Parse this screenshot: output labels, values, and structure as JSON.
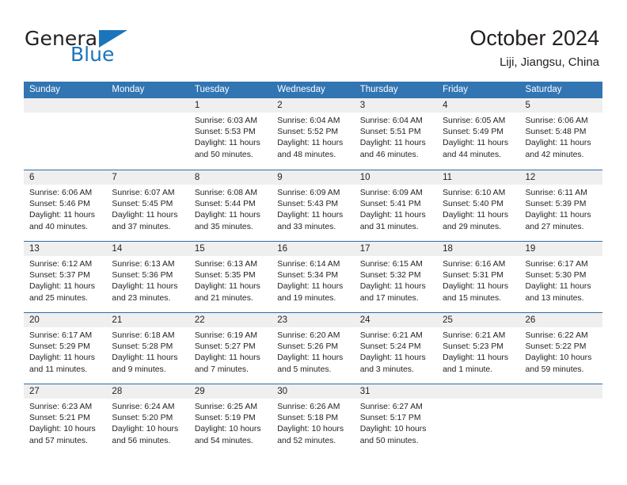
{
  "brand": {
    "name_top": "General",
    "name_bottom": "Blue",
    "accent_color": "#1b75bb"
  },
  "header": {
    "title": "October 2024",
    "subtitle": "Liji, Jiangsu, China"
  },
  "theme": {
    "header_blue": "#3275b3",
    "row_border_blue": "#2e6da4",
    "day_band_gray": "#efefef",
    "text_color": "#231f20"
  },
  "weekdays": [
    "Sunday",
    "Monday",
    "Tuesday",
    "Wednesday",
    "Thursday",
    "Friday",
    "Saturday"
  ],
  "weeks": [
    [
      {
        "day": "",
        "sunrise": "",
        "sunset": "",
        "daylight_line1": "",
        "daylight_line2": ""
      },
      {
        "day": "",
        "sunrise": "",
        "sunset": "",
        "daylight_line1": "",
        "daylight_line2": ""
      },
      {
        "day": "1",
        "sunrise": "Sunrise: 6:03 AM",
        "sunset": "Sunset: 5:53 PM",
        "daylight_line1": "Daylight: 11 hours",
        "daylight_line2": "and 50 minutes."
      },
      {
        "day": "2",
        "sunrise": "Sunrise: 6:04 AM",
        "sunset": "Sunset: 5:52 PM",
        "daylight_line1": "Daylight: 11 hours",
        "daylight_line2": "and 48 minutes."
      },
      {
        "day": "3",
        "sunrise": "Sunrise: 6:04 AM",
        "sunset": "Sunset: 5:51 PM",
        "daylight_line1": "Daylight: 11 hours",
        "daylight_line2": "and 46 minutes."
      },
      {
        "day": "4",
        "sunrise": "Sunrise: 6:05 AM",
        "sunset": "Sunset: 5:49 PM",
        "daylight_line1": "Daylight: 11 hours",
        "daylight_line2": "and 44 minutes."
      },
      {
        "day": "5",
        "sunrise": "Sunrise: 6:06 AM",
        "sunset": "Sunset: 5:48 PM",
        "daylight_line1": "Daylight: 11 hours",
        "daylight_line2": "and 42 minutes."
      }
    ],
    [
      {
        "day": "6",
        "sunrise": "Sunrise: 6:06 AM",
        "sunset": "Sunset: 5:46 PM",
        "daylight_line1": "Daylight: 11 hours",
        "daylight_line2": "and 40 minutes."
      },
      {
        "day": "7",
        "sunrise": "Sunrise: 6:07 AM",
        "sunset": "Sunset: 5:45 PM",
        "daylight_line1": "Daylight: 11 hours",
        "daylight_line2": "and 37 minutes."
      },
      {
        "day": "8",
        "sunrise": "Sunrise: 6:08 AM",
        "sunset": "Sunset: 5:44 PM",
        "daylight_line1": "Daylight: 11 hours",
        "daylight_line2": "and 35 minutes."
      },
      {
        "day": "9",
        "sunrise": "Sunrise: 6:09 AM",
        "sunset": "Sunset: 5:43 PM",
        "daylight_line1": "Daylight: 11 hours",
        "daylight_line2": "and 33 minutes."
      },
      {
        "day": "10",
        "sunrise": "Sunrise: 6:09 AM",
        "sunset": "Sunset: 5:41 PM",
        "daylight_line1": "Daylight: 11 hours",
        "daylight_line2": "and 31 minutes."
      },
      {
        "day": "11",
        "sunrise": "Sunrise: 6:10 AM",
        "sunset": "Sunset: 5:40 PM",
        "daylight_line1": "Daylight: 11 hours",
        "daylight_line2": "and 29 minutes."
      },
      {
        "day": "12",
        "sunrise": "Sunrise: 6:11 AM",
        "sunset": "Sunset: 5:39 PM",
        "daylight_line1": "Daylight: 11 hours",
        "daylight_line2": "and 27 minutes."
      }
    ],
    [
      {
        "day": "13",
        "sunrise": "Sunrise: 6:12 AM",
        "sunset": "Sunset: 5:37 PM",
        "daylight_line1": "Daylight: 11 hours",
        "daylight_line2": "and 25 minutes."
      },
      {
        "day": "14",
        "sunrise": "Sunrise: 6:13 AM",
        "sunset": "Sunset: 5:36 PM",
        "daylight_line1": "Daylight: 11 hours",
        "daylight_line2": "and 23 minutes."
      },
      {
        "day": "15",
        "sunrise": "Sunrise: 6:13 AM",
        "sunset": "Sunset: 5:35 PM",
        "daylight_line1": "Daylight: 11 hours",
        "daylight_line2": "and 21 minutes."
      },
      {
        "day": "16",
        "sunrise": "Sunrise: 6:14 AM",
        "sunset": "Sunset: 5:34 PM",
        "daylight_line1": "Daylight: 11 hours",
        "daylight_line2": "and 19 minutes."
      },
      {
        "day": "17",
        "sunrise": "Sunrise: 6:15 AM",
        "sunset": "Sunset: 5:32 PM",
        "daylight_line1": "Daylight: 11 hours",
        "daylight_line2": "and 17 minutes."
      },
      {
        "day": "18",
        "sunrise": "Sunrise: 6:16 AM",
        "sunset": "Sunset: 5:31 PM",
        "daylight_line1": "Daylight: 11 hours",
        "daylight_line2": "and 15 minutes."
      },
      {
        "day": "19",
        "sunrise": "Sunrise: 6:17 AM",
        "sunset": "Sunset: 5:30 PM",
        "daylight_line1": "Daylight: 11 hours",
        "daylight_line2": "and 13 minutes."
      }
    ],
    [
      {
        "day": "20",
        "sunrise": "Sunrise: 6:17 AM",
        "sunset": "Sunset: 5:29 PM",
        "daylight_line1": "Daylight: 11 hours",
        "daylight_line2": "and 11 minutes."
      },
      {
        "day": "21",
        "sunrise": "Sunrise: 6:18 AM",
        "sunset": "Sunset: 5:28 PM",
        "daylight_line1": "Daylight: 11 hours",
        "daylight_line2": "and 9 minutes."
      },
      {
        "day": "22",
        "sunrise": "Sunrise: 6:19 AM",
        "sunset": "Sunset: 5:27 PM",
        "daylight_line1": "Daylight: 11 hours",
        "daylight_line2": "and 7 minutes."
      },
      {
        "day": "23",
        "sunrise": "Sunrise: 6:20 AM",
        "sunset": "Sunset: 5:26 PM",
        "daylight_line1": "Daylight: 11 hours",
        "daylight_line2": "and 5 minutes."
      },
      {
        "day": "24",
        "sunrise": "Sunrise: 6:21 AM",
        "sunset": "Sunset: 5:24 PM",
        "daylight_line1": "Daylight: 11 hours",
        "daylight_line2": "and 3 minutes."
      },
      {
        "day": "25",
        "sunrise": "Sunrise: 6:21 AM",
        "sunset": "Sunset: 5:23 PM",
        "daylight_line1": "Daylight: 11 hours",
        "daylight_line2": "and 1 minute."
      },
      {
        "day": "26",
        "sunrise": "Sunrise: 6:22 AM",
        "sunset": "Sunset: 5:22 PM",
        "daylight_line1": "Daylight: 10 hours",
        "daylight_line2": "and 59 minutes."
      }
    ],
    [
      {
        "day": "27",
        "sunrise": "Sunrise: 6:23 AM",
        "sunset": "Sunset: 5:21 PM",
        "daylight_line1": "Daylight: 10 hours",
        "daylight_line2": "and 57 minutes."
      },
      {
        "day": "28",
        "sunrise": "Sunrise: 6:24 AM",
        "sunset": "Sunset: 5:20 PM",
        "daylight_line1": "Daylight: 10 hours",
        "daylight_line2": "and 56 minutes."
      },
      {
        "day": "29",
        "sunrise": "Sunrise: 6:25 AM",
        "sunset": "Sunset: 5:19 PM",
        "daylight_line1": "Daylight: 10 hours",
        "daylight_line2": "and 54 minutes."
      },
      {
        "day": "30",
        "sunrise": "Sunrise: 6:26 AM",
        "sunset": "Sunset: 5:18 PM",
        "daylight_line1": "Daylight: 10 hours",
        "daylight_line2": "and 52 minutes."
      },
      {
        "day": "31",
        "sunrise": "Sunrise: 6:27 AM",
        "sunset": "Sunset: 5:17 PM",
        "daylight_line1": "Daylight: 10 hours",
        "daylight_line2": "and 50 minutes."
      },
      {
        "day": "",
        "sunrise": "",
        "sunset": "",
        "daylight_line1": "",
        "daylight_line2": ""
      },
      {
        "day": "",
        "sunrise": "",
        "sunset": "",
        "daylight_line1": "",
        "daylight_line2": ""
      }
    ]
  ]
}
